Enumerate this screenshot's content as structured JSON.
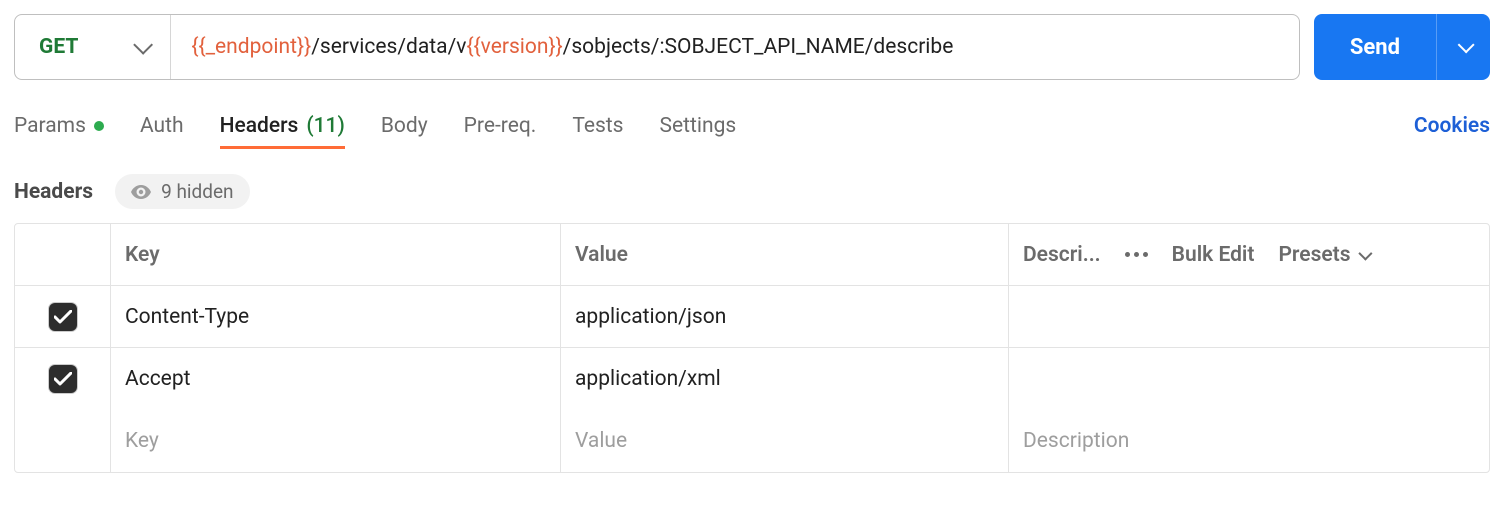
{
  "request": {
    "method": "GET",
    "url_parts": [
      {
        "text": "{{_endpoint}}",
        "var": true
      },
      {
        "text": "/services/data/v",
        "var": false
      },
      {
        "text": "{{version}}",
        "var": true
      },
      {
        "text": "/sobjects/:SOBJECT_API_NAME/describe",
        "var": false
      }
    ],
    "send_label": "Send"
  },
  "tabs": {
    "params": "Params",
    "auth": "Auth",
    "headers": "Headers",
    "headers_count": "(11)",
    "body": "Body",
    "prereq": "Pre-req.",
    "tests": "Tests",
    "settings": "Settings",
    "cookies": "Cookies"
  },
  "headers_section": {
    "title": "Headers",
    "hidden_label": "9 hidden",
    "columns": {
      "key": "Key",
      "value": "Value",
      "description": "Descri...",
      "bulk_edit": "Bulk Edit",
      "presets": "Presets"
    },
    "rows": [
      {
        "enabled": true,
        "key": "Content-Type",
        "value": "application/json"
      },
      {
        "enabled": true,
        "key": "Accept",
        "value": "application/xml"
      }
    ],
    "placeholders": {
      "key": "Key",
      "value": "Value",
      "description": "Description"
    }
  }
}
